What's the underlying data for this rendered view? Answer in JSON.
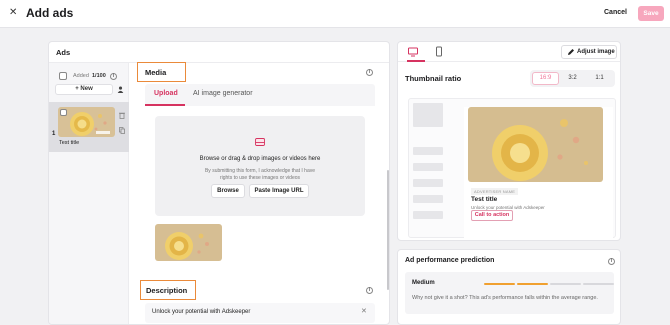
{
  "header": {
    "close_icon": "close-icon",
    "title": "Add ads",
    "cancel_label": "Cancel",
    "save_label": "Save"
  },
  "ads": {
    "title": "Ads",
    "added_label": "Added",
    "added_count": "1/100",
    "new_label": "+ New",
    "items": [
      {
        "number": "1",
        "title": "Test title"
      }
    ]
  },
  "media": {
    "title": "Media",
    "tabs": [
      {
        "label": "Upload",
        "active": true
      },
      {
        "label": "AI image generator",
        "active": false
      }
    ],
    "dropzone_title": "Browse or drag & drop images or videos here",
    "dropzone_note": "By submitting this form, I acknowledge that I have rights to use these images or videos",
    "browse_label": "Browse",
    "paste_label": "Paste Image URL"
  },
  "description": {
    "title": "Description",
    "value": "Unlock your potential with Adskeeper"
  },
  "preview": {
    "adjust_label": "Adjust image",
    "ratio_title": "Thumbnail ratio",
    "ratios": [
      {
        "label": "16:9",
        "active": true
      },
      {
        "label": "3:2",
        "active": false
      },
      {
        "label": "1:1",
        "active": false
      }
    ],
    "advertiser_tag": "ADVERTISER NAME",
    "card_title": "Test title",
    "card_subtitle": "Unlock your potential with Adskeeper",
    "cta_label": "Call to action"
  },
  "performance": {
    "title": "Ad performance prediction",
    "level": "Medium",
    "level_fraction": 0.5,
    "message": "Why not give it a shot? This ad's performance falls within the average range."
  },
  "colors": {
    "accent": "#d63360",
    "save_disabled": "#f7a7bd",
    "highlight": "#ea8a3a",
    "perf_filled": "#f0a030",
    "perf_empty": "#d8d8dc"
  }
}
